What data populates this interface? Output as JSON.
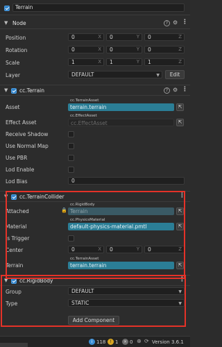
{
  "node_name": {
    "enabled": true,
    "value": "Terrain"
  },
  "node_section": {
    "title": "Node",
    "position": {
      "label": "Position",
      "x": "0",
      "y": "0",
      "z": "0"
    },
    "rotation": {
      "label": "Rotation",
      "x": "0",
      "y": "0",
      "z": "0"
    },
    "scale": {
      "label": "Scale",
      "x": "1",
      "y": "1",
      "z": "1"
    },
    "layer": {
      "label": "Layer",
      "value": "DEFAULT",
      "edit_label": "Edit"
    }
  },
  "axes": {
    "x": "X",
    "y": "Y",
    "z": "Z"
  },
  "terrain_section": {
    "title": "cc.Terrain",
    "asset": {
      "label": "Asset",
      "type": "cc.TerrainAsset",
      "value": "terrain.terrain"
    },
    "effect_asset": {
      "label": "Effect Asset",
      "type": "cc.EffectAsset",
      "value": "cc.EffectAsset"
    },
    "receive_shadow": {
      "label": "Receive Shadow"
    },
    "use_normal_map": {
      "label": "Use Normal Map"
    },
    "use_pbr": {
      "label": "Use PBR"
    },
    "lod_enable": {
      "label": "Lod Enable"
    },
    "lod_bias": {
      "label": "Lod Bias",
      "value": "0"
    }
  },
  "collider_section": {
    "title": "cc.TerrainCollider",
    "attached": {
      "label": "Attached",
      "type": "cc.RigidBody",
      "value": "Terrain"
    },
    "material": {
      "label": "Material",
      "type": "cc.PhysicsMaterial",
      "value": "default-physics-material.pmtl"
    },
    "is_trigger": {
      "label": "Is Trigger"
    },
    "center": {
      "label": "Center",
      "x": "0",
      "y": "0",
      "z": "0"
    },
    "terrain": {
      "label": "Terrain",
      "type": "cc.TerrainAsset",
      "value": "terrain.terrain"
    }
  },
  "rigidbody_section": {
    "title": "cc.RigidBody",
    "group": {
      "label": "Group",
      "value": "DEFAULT"
    },
    "type": {
      "label": "Type",
      "value": "STATIC"
    }
  },
  "add_component_label": "Add Component",
  "status_bar": {
    "info": "118",
    "warn": "1",
    "error": "0",
    "version": "Version 3.6.1"
  },
  "colors": {
    "highlight": "#e53228",
    "asset": "#2b7e96",
    "checkbox": "#2f82c9"
  }
}
